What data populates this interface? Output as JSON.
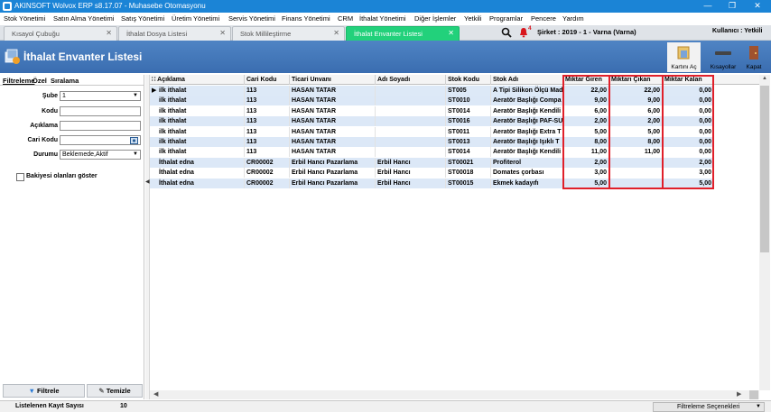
{
  "window": {
    "title": "AKINSOFT Wolvox ERP s8.17.07 - Muhasebe Otomasyonu"
  },
  "menu": [
    "Stok Yönetimi",
    "Satın Alma Yönetimi",
    "Satış Yönetimi",
    "Üretim Yönetimi",
    "Servis Yönetimi",
    "Finans Yönetimi",
    "CRM",
    "İthalat Yönetimi",
    "Diğer İşlemler",
    "Yetkili",
    "Programlar",
    "Pencere",
    "Yardım"
  ],
  "tabs": [
    {
      "label": "Kısayol Çubuğu"
    },
    {
      "label": "İthalat Dosya Listesi"
    },
    {
      "label": "Stok Millileştirme"
    },
    {
      "label": "İthalat Envanter Listesi"
    }
  ],
  "topbar": {
    "company": "Şirket : 2019 - 1 - Varna (Varna)",
    "user": "Kullanıcı : Yetkili",
    "notification_count": "4"
  },
  "header": {
    "title": "İthalat Envanter Listesi",
    "buttons": [
      "Kartını Aç",
      "Kısayollar",
      "Kapat"
    ]
  },
  "filter": {
    "tabs": [
      "Filtreleme",
      "Özel",
      "Sıralama"
    ],
    "fields": [
      {
        "label": "Şube",
        "value": "1"
      },
      {
        "label": "Kodu",
        "value": ""
      },
      {
        "label": "Açıklama",
        "value": ""
      },
      {
        "label": "Cari Kodu",
        "value": ""
      },
      {
        "label": "Durumu",
        "value": "Beklemede,Aktif"
      }
    ],
    "checkbox": "Bakiyesi olanları göster",
    "filter_button": "Filtrele",
    "clear_button": "Temizle"
  },
  "grid": {
    "columns": [
      "Açıklama",
      "Cari Kodu",
      "Ticari Unvanı",
      "Adı Soyadı",
      "Stok Kodu",
      "Stok Adı",
      "Miktar Giren",
      "Miktarı Çıkan",
      "Miktar Kalan"
    ],
    "rows": [
      [
        "ilk ithalat",
        "113",
        "HASAN TATAR",
        "",
        "ST005",
        "A Tipi Silikon Ölçü Mad",
        "22,00",
        "22,00",
        "0,00"
      ],
      [
        "ilk ithalat",
        "113",
        "HASAN TATAR",
        "",
        "ST0010",
        "Aeratör Başlığı Compa",
        "9,00",
        "9,00",
        "0,00"
      ],
      [
        "ilk ithalat",
        "113",
        "HASAN TATAR",
        "",
        "ST0014",
        "Aeratör Başlığı Kendili",
        "6,00",
        "6,00",
        "0,00"
      ],
      [
        "ilk ithalat",
        "113",
        "HASAN TATAR",
        "",
        "ST0016",
        "Aeratör Başlığı PAF-SU",
        "2,00",
        "2,00",
        "0,00"
      ],
      [
        "ilk ithalat",
        "113",
        "HASAN TATAR",
        "",
        "ST0011",
        "Aeratör Başlığı Extra T",
        "5,00",
        "5,00",
        "0,00"
      ],
      [
        "ilk ithalat",
        "113",
        "HASAN TATAR",
        "",
        "ST0013",
        "Aeratör Başlığı Işıklı T",
        "8,00",
        "8,00",
        "0,00"
      ],
      [
        "ilk ithalat",
        "113",
        "HASAN TATAR",
        "",
        "ST0014",
        "Aeratör Başlığı Kendili",
        "11,00",
        "11,00",
        "0,00"
      ],
      [
        "İthalat edna",
        "CR00002",
        "Erbil Hancı Pazarlama",
        "Erbil Hancı",
        "ST00021",
        "Profiterol",
        "2,00",
        "",
        "2,00"
      ],
      [
        "İthalat edna",
        "CR00002",
        "Erbil Hancı Pazarlama",
        "Erbil Hancı",
        "ST00018",
        "Domates çorbası",
        "3,00",
        "",
        "3,00"
      ],
      [
        "İthalat edna",
        "CR00002",
        "Erbil Hancı Pazarlama",
        "Erbil Hancı",
        "ST00015",
        "Ekmek kadayıfı",
        "5,00",
        "",
        "5,00"
      ]
    ]
  },
  "status": {
    "count_label": "Listelenen Kayıt Sayısı",
    "count_value": "10",
    "options_button": "Filtreleme Seçenekleri"
  }
}
